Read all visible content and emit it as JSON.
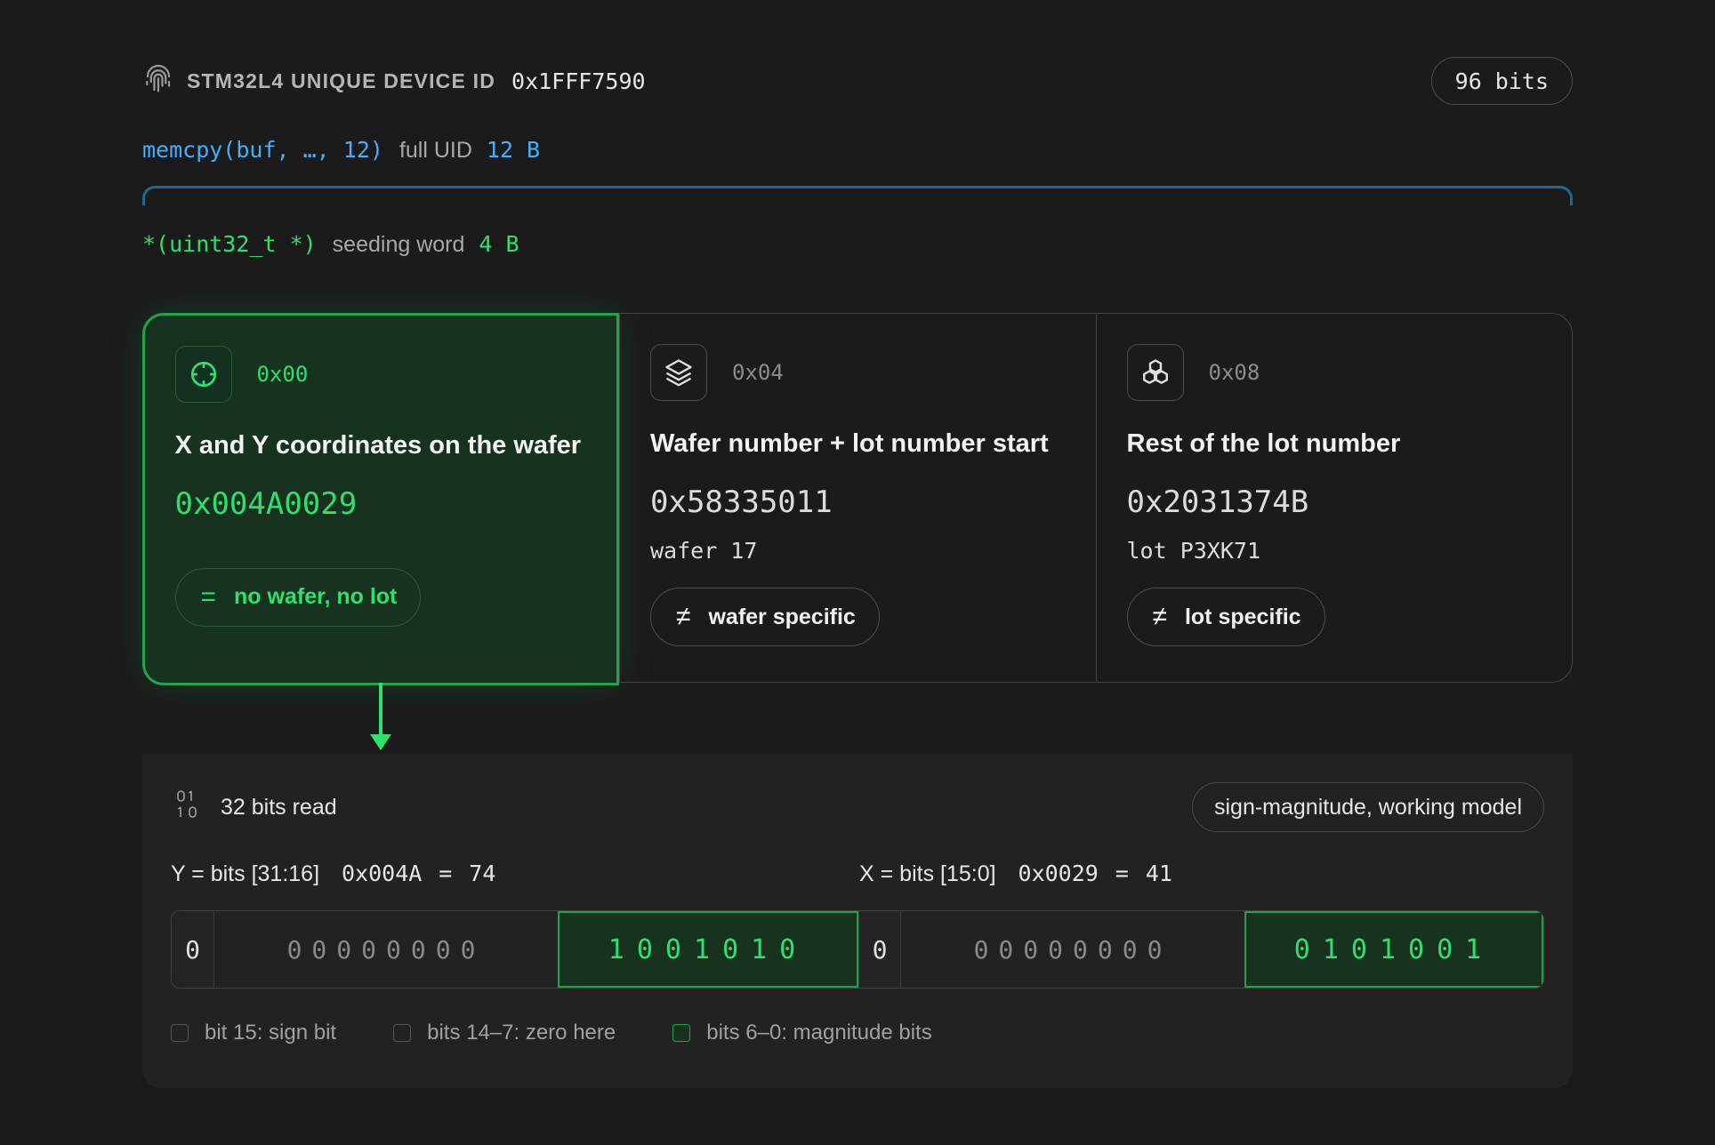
{
  "header": {
    "title": "STM32L4 UNIQUE DEVICE ID",
    "address": "0x1FFF7590",
    "bits_badge": "96 bits"
  },
  "full_uid": {
    "code": "memcpy(buf, …, 12)",
    "label": "full UID",
    "size": "12 B"
  },
  "seeding": {
    "code": "*(uint32_t *)",
    "label": "seeding word",
    "size": "4 B"
  },
  "cards": [
    {
      "icon": "crosshair-icon",
      "offset": "0x00",
      "title": "X and Y coordinates on the wafer",
      "value": "0x004A0029",
      "sub": "",
      "pill_symbol": "=",
      "pill_label": "no wafer, no lot"
    },
    {
      "icon": "layers-icon",
      "offset": "0x04",
      "title": "Wafer number + lot number start",
      "value": "0x58335011",
      "sub": "wafer 17",
      "pill_symbol": "≠",
      "pill_label": "wafer specific"
    },
    {
      "icon": "boxes-icon",
      "offset": "0x08",
      "title": "Rest of the lot number",
      "value": "0x2031374B",
      "sub": "lot P3XK71",
      "pill_symbol": "≠",
      "pill_label": "lot specific"
    }
  ],
  "bits": {
    "read_label": "32 bits read",
    "model": "sign-magnitude, working model",
    "y_field": {
      "label": "Y = bits [31:16]",
      "hex": "0x004A",
      "eq": "=",
      "dec": "74"
    },
    "x_field": {
      "label": "X = bits [15:0]",
      "hex": "0x0029",
      "eq": "=",
      "dec": "41"
    },
    "y_sign": "0",
    "y_zeros": "00000000",
    "y_mag": "1001010",
    "x_sign": "0",
    "x_zeros": "00000000",
    "x_mag": "0101001"
  },
  "legend": [
    "bit 15: sign bit",
    "bits 14–7: zero here",
    "bits 6–0: magnitude bits"
  ],
  "colors": {
    "accent": "#2ee06d",
    "link": "#3fb1ff",
    "background": "#1b1b1b"
  }
}
